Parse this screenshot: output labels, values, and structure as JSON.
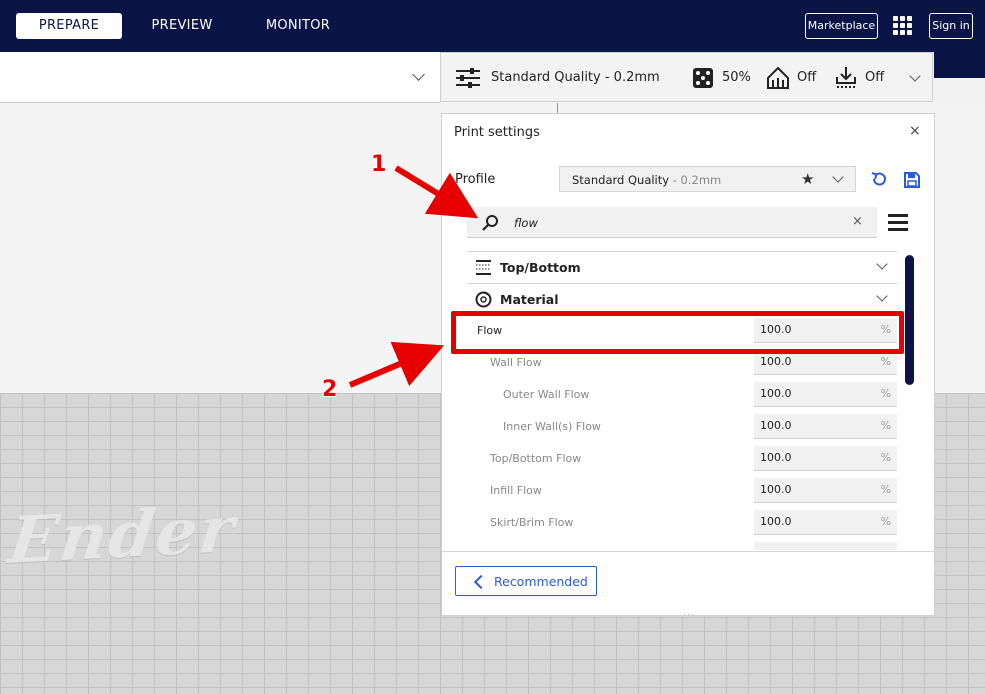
{
  "header": {
    "tabs": [
      {
        "label": "PREPARE",
        "active": true
      },
      {
        "label": "PREVIEW",
        "active": false
      },
      {
        "label": "MONITOR",
        "active": false
      }
    ],
    "marketplace_label": "Marketplace",
    "sign_in_label": "Sign in",
    "apps_icon": "grid-icon"
  },
  "quality_bar": {
    "profile": "Standard Quality - 0.2mm",
    "infill": "50%",
    "support": "Off",
    "adhesion": "Off"
  },
  "print_settings": {
    "title": "Print settings",
    "close": "×",
    "profile_label": "Profile",
    "profile_name": "Standard Quality",
    "profile_sub": " - 0.2mm",
    "search_value": "flow",
    "search_clear": "×",
    "categories": [
      {
        "label": "Top/Bottom",
        "icon": "top-bottom-icon"
      },
      {
        "label": "Material",
        "icon": "material-icon"
      }
    ],
    "settings": [
      {
        "label": "Flow",
        "value": "100.0",
        "unit": "%"
      },
      {
        "label": "Wall Flow",
        "value": "100.0",
        "unit": "%"
      },
      {
        "label": "Outer Wall Flow",
        "value": "100.0",
        "unit": "%"
      },
      {
        "label": "Inner Wall(s) Flow",
        "value": "100.0",
        "unit": "%"
      },
      {
        "label": "Top/Bottom Flow",
        "value": "100.0",
        "unit": "%"
      },
      {
        "label": "Infill Flow",
        "value": "100.0",
        "unit": "%"
      },
      {
        "label": "Skirt/Brim Flow",
        "value": "100.0",
        "unit": "%"
      }
    ],
    "recommended_label": "Recommended",
    "resize_handle": "..."
  },
  "viewport": {
    "plate_logo": "Ender"
  },
  "annotations": {
    "step1": "1",
    "step2": "2",
    "color": "#e60000"
  },
  "colors": {
    "header_bg": "#0b1447",
    "accent": "#2b5bd7"
  }
}
